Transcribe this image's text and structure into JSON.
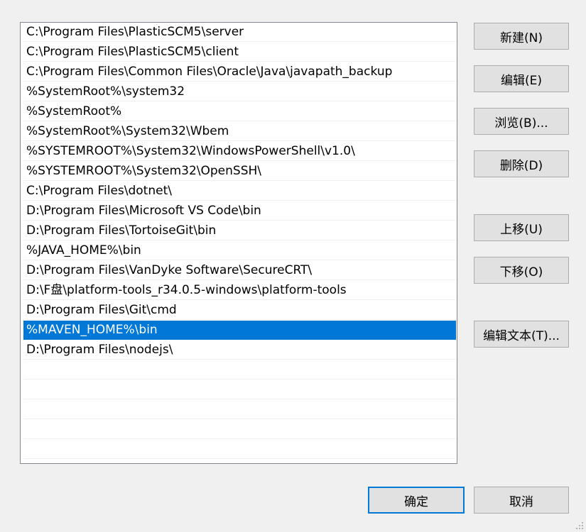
{
  "path_list": {
    "selected_index": 15,
    "items": [
      "C:\\Program Files\\PlasticSCM5\\server",
      "C:\\Program Files\\PlasticSCM5\\client",
      "C:\\Program Files\\Common Files\\Oracle\\Java\\javapath_backup",
      "%SystemRoot%\\system32",
      "%SystemRoot%",
      "%SystemRoot%\\System32\\Wbem",
      "%SYSTEMROOT%\\System32\\WindowsPowerShell\\v1.0\\",
      "%SYSTEMROOT%\\System32\\OpenSSH\\",
      "C:\\Program Files\\dotnet\\",
      "D:\\Program Files\\Microsoft VS Code\\bin",
      "D:\\Program Files\\TortoiseGit\\bin",
      "%JAVA_HOME%\\bin",
      "D:\\Program Files\\VanDyke Software\\SecureCRT\\",
      "D:\\F盘\\platform-tools_r34.0.5-windows\\platform-tools",
      "D:\\Program Files\\Git\\cmd",
      "%MAVEN_HOME%\\bin",
      "D:\\Program Files\\nodejs\\",
      "",
      "",
      "",
      "",
      ""
    ]
  },
  "buttons": {
    "new": "新建(N)",
    "edit": "编辑(E)",
    "browse": "浏览(B)...",
    "delete": "删除(D)",
    "move_up": "上移(U)",
    "move_down": "下移(O)",
    "edit_text": "编辑文本(T)...",
    "ok": "确定",
    "cancel": "取消"
  },
  "colors": {
    "selection": "#0078d7",
    "dialog_background": "#f0f0f0",
    "button_face": "#e1e1e1"
  }
}
